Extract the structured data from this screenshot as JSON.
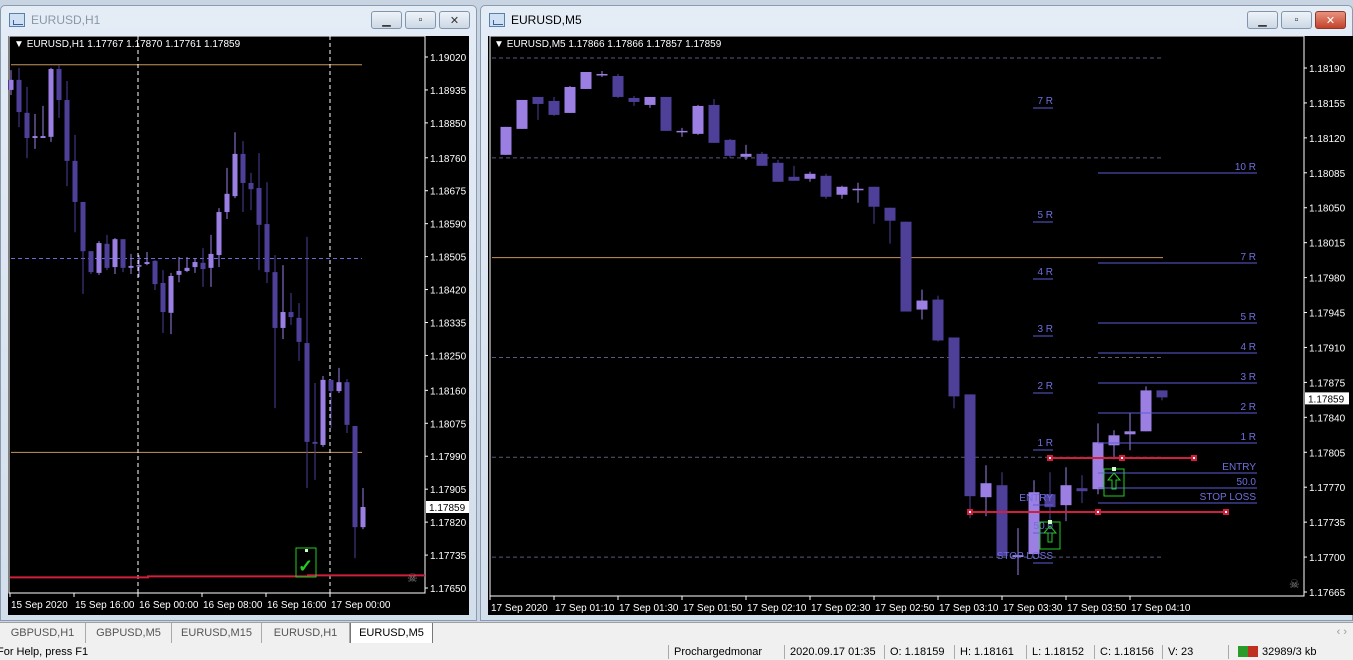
{
  "colors": {
    "bull": "#9b7fe3",
    "bear": "#4e3f99",
    "level_line": "#5c5cd6",
    "level_text": "#6f6fe0",
    "orange": "#c8955a",
    "red": "#d0203c",
    "green": "#22cc22",
    "grid": "#6a6a8a"
  },
  "left_window": {
    "title": "EURUSD,H1",
    "active": false,
    "header": "EURUSD,H1  1.17767 1.17870 1.17761 1.17859",
    "current_price": "1.17859",
    "y_ticks": [
      "1.19020",
      "1.18935",
      "1.18850",
      "1.18760",
      "1.18675",
      "1.18590",
      "1.18505",
      "1.18420",
      "1.18335",
      "1.18250",
      "1.18160",
      "1.18075",
      "1.17990",
      "1.17905",
      "1.17820",
      "1.17735",
      "1.17650"
    ],
    "x_ticks": [
      "15 Sep 2020",
      "15 Sep 16:00",
      "16 Sep 00:00",
      "16 Sep 08:00",
      "16 Sep 16:00",
      "17 Sep 00:00"
    ],
    "levels": {
      "orange": [
        1.19,
        1.18
      ],
      "dashed": [
        1.185
      ],
      "red": 1.1768
    },
    "candles": [
      [
        1.18935,
        1.18986,
        1.18922,
        1.18961
      ],
      [
        1.18961,
        1.18992,
        1.18839,
        1.18878
      ],
      [
        1.18876,
        1.18943,
        1.18759,
        1.18811
      ],
      [
        1.18811,
        1.18873,
        1.18783,
        1.18816
      ],
      [
        1.18811,
        1.18894,
        1.18811,
        1.18816
      ],
      [
        1.18814,
        1.18992,
        1.18801,
        1.18989
      ],
      [
        1.18989,
        1.18999,
        1.18863,
        1.18909
      ],
      [
        1.18909,
        1.18958,
        1.18687,
        1.18752
      ],
      [
        1.18752,
        1.18819,
        1.18568,
        1.18646
      ],
      [
        1.18646,
        1.18646,
        1.18409,
        1.18519
      ],
      [
        1.18519,
        1.18519,
        1.1846,
        1.18465
      ],
      [
        1.18463,
        1.18545,
        1.18458,
        1.1854
      ],
      [
        1.18538,
        1.18561,
        1.1847,
        1.18476
      ],
      [
        1.18478,
        1.18553,
        1.1846,
        1.1855
      ],
      [
        1.1855,
        1.1855,
        1.18465,
        1.18476
      ],
      [
        1.18476,
        1.18512,
        1.1846,
        1.18481
      ],
      [
        1.18481,
        1.18509,
        1.18452,
        1.18483
      ],
      [
        1.18486,
        1.18517,
        1.18483,
        1.18491
      ],
      [
        1.18494,
        1.18496,
        1.18419,
        1.18434
      ],
      [
        1.18437,
        1.1847,
        1.18308,
        1.18362
      ],
      [
        1.1836,
        1.18463,
        1.18305,
        1.18455
      ],
      [
        1.18458,
        1.18504,
        1.18439,
        1.18468
      ],
      [
        1.18468,
        1.18504,
        1.18465,
        1.18476
      ],
      [
        1.18478,
        1.18501,
        1.18463,
        1.18491
      ],
      [
        1.18489,
        1.18527,
        1.18427,
        1.18473
      ],
      [
        1.18476,
        1.18561,
        1.18427,
        1.18512
      ],
      [
        1.18509,
        1.1863,
        1.18478,
        1.1862
      ],
      [
        1.1862,
        1.18734,
        1.18602,
        1.18667
      ],
      [
        1.18661,
        1.18826,
        1.18656,
        1.1877
      ],
      [
        1.1877,
        1.18803,
        1.1862,
        1.18695
      ],
      [
        1.18695,
        1.18721,
        1.18625,
        1.18679
      ],
      [
        1.18682,
        1.18772,
        1.1847,
        1.18587
      ],
      [
        1.18589,
        1.18697,
        1.18437,
        1.18465
      ],
      [
        1.18465,
        1.18509,
        1.18114,
        1.18321
      ],
      [
        1.18321,
        1.18483,
        1.18292,
        1.18362
      ],
      [
        1.18362,
        1.18411,
        1.18329,
        1.18349
      ],
      [
        1.18347,
        1.18385,
        1.18236,
        1.18285
      ],
      [
        1.18282,
        1.18556,
        1.17908,
        1.18027
      ],
      [
        1.18027,
        1.18179,
        1.17929,
        1.18022
      ],
      [
        1.18019,
        1.18197,
        1.18014,
        1.18187
      ],
      [
        1.18187,
        1.18187,
        1.18063,
        1.18158
      ],
      [
        1.18158,
        1.18218,
        1.18153,
        1.18181
      ],
      [
        1.18181,
        1.18189,
        1.1805,
        1.18071
      ],
      [
        1.18068,
        1.18068,
        1.17727,
        1.17807
      ],
      [
        1.17807,
        1.17908,
        1.17802,
        1.17859
      ]
    ]
  },
  "right_window": {
    "title": "EURUSD,M5",
    "active": true,
    "header": "EURUSD,M5  1.17866 1.17866 1.17857 1.17859",
    "current_price": "1.17859",
    "y_ticks": [
      "1.18190",
      "1.18155",
      "1.18120",
      "1.18085",
      "1.18050",
      "1.18015",
      "1.17980",
      "1.17945",
      "1.17910",
      "1.17875",
      "1.17840",
      "1.17805",
      "1.17770",
      "1.17735",
      "1.17700",
      "1.17665"
    ],
    "x_ticks": [
      "17 Sep 2020",
      "17 Sep 01:10",
      "17 Sep 01:30",
      "17 Sep 01:50",
      "17 Sep 02:10",
      "17 Sep 02:30",
      "17 Sep 02:50",
      "17 Sep 03:10",
      "17 Sep 03:30",
      "17 Sep 03:50",
      "17 Sep 04:10"
    ],
    "levels": {
      "orange": [
        1.18
      ],
      "dashed": [
        1.182,
        1.181,
        1.179,
        1.178,
        1.177
      ]
    },
    "trade1_labels": [
      "7  R",
      "5  R",
      "4  R",
      "3  R",
      "2  R",
      "1  R",
      "ENTRY",
      "50.0",
      "STOP LOSS"
    ],
    "trade2_labels": [
      "10  R",
      "7  R",
      "5  R",
      "4  R",
      "3  R",
      "2  R",
      "1  R",
      "ENTRY",
      "50.0",
      "STOP LOSS"
    ],
    "candles": [
      [
        1.18103,
        1.18131,
        1.18103,
        1.18131
      ],
      [
        1.18129,
        1.18158,
        1.18129,
        1.18158
      ],
      [
        1.18161,
        1.18161,
        1.18138,
        1.18154
      ],
      [
        1.18157,
        1.18161,
        1.18142,
        1.18143
      ],
      [
        1.18145,
        1.18172,
        1.18145,
        1.18171
      ],
      [
        1.18169,
        1.18186,
        1.18169,
        1.18186
      ],
      [
        1.18183,
        1.18187,
        1.18181,
        1.18184
      ],
      [
        1.18182,
        1.18184,
        1.1816,
        1.18161
      ],
      [
        1.1816,
        1.18162,
        1.18152,
        1.18156
      ],
      [
        1.18153,
        1.18161,
        1.1815,
        1.18161
      ],
      [
        1.18161,
        1.18161,
        1.18127,
        1.18127
      ],
      [
        1.18126,
        1.1813,
        1.18121,
        1.18127
      ],
      [
        1.18124,
        1.18153,
        1.18123,
        1.18152
      ],
      [
        1.18153,
        1.18159,
        1.18115,
        1.18115
      ],
      [
        1.18118,
        1.18119,
        1.181,
        1.18102
      ],
      [
        1.18101,
        1.18113,
        1.18098,
        1.18104
      ],
      [
        1.18104,
        1.18106,
        1.18092,
        1.18092
      ],
      [
        1.18095,
        1.18098,
        1.18076,
        1.18076
      ],
      [
        1.18081,
        1.18092,
        1.18077,
        1.18077
      ],
      [
        1.18079,
        1.18086,
        1.18076,
        1.18084
      ],
      [
        1.18082,
        1.18084,
        1.18059,
        1.18061
      ],
      [
        1.18063,
        1.18072,
        1.18059,
        1.18071
      ],
      [
        1.18069,
        1.18075,
        1.18055,
        1.18069
      ],
      [
        1.18071,
        1.18071,
        1.18034,
        1.18051
      ],
      [
        1.1805,
        1.1805,
        1.18014,
        1.18037
      ],
      [
        1.18036,
        1.18036,
        1.17946,
        1.17946
      ],
      [
        1.17948,
        1.17968,
        1.17938,
        1.17957
      ],
      [
        1.17958,
        1.17962,
        1.17916,
        1.17917
      ],
      [
        1.1792,
        1.1792,
        1.17849,
        1.17861
      ],
      [
        1.17863,
        1.17863,
        1.17739,
        1.17761
      ],
      [
        1.1776,
        1.17792,
        1.17741,
        1.17774
      ],
      [
        1.17772,
        1.17785,
        1.17701,
        1.17701
      ],
      [
        1.177,
        1.17729,
        1.17682,
        1.17702
      ],
      [
        1.17703,
        1.17777,
        1.17703,
        1.17765
      ],
      [
        1.17763,
        1.17785,
        1.17728,
        1.1775
      ],
      [
        1.17752,
        1.1779,
        1.17736,
        1.17772
      ],
      [
        1.17769,
        1.17782,
        1.17754,
        1.17766
      ],
      [
        1.17768,
        1.17834,
        1.17763,
        1.17815
      ],
      [
        1.17812,
        1.17827,
        1.17798,
        1.17822
      ],
      [
        1.17823,
        1.17844,
        1.17807,
        1.17826
      ],
      [
        1.17826,
        1.17871,
        1.17826,
        1.17867
      ],
      [
        1.17867,
        1.17867,
        1.17857,
        1.1786
      ]
    ]
  },
  "tabs": [
    "GBPUSD,H1",
    "GBPUSD,M5",
    "EURUSD,M15",
    "EURUSD,H1",
    "EURUSD,M5"
  ],
  "active_tab": "EURUSD,M5",
  "tab_scroll": "‹ ›",
  "status": {
    "help": "For Help, press F1",
    "profile": "Prochargedmonar",
    "datetime": "2020.09.17 01:35",
    "open": "O: 1.18159",
    "high": "H: 1.18161",
    "low": "L: 1.18152",
    "close": "C: 1.18156",
    "volume": "V: 23",
    "traffic": "32989/3 kb"
  }
}
